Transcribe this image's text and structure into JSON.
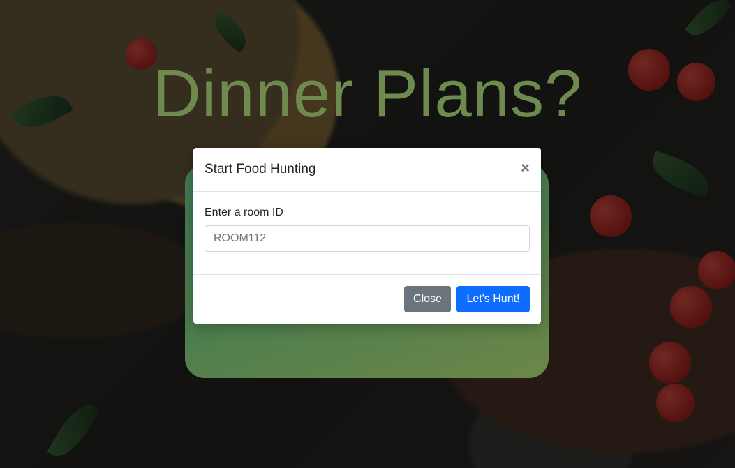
{
  "hero": {
    "title": "Dinner Plans?"
  },
  "modal": {
    "title": "Start Food Hunting",
    "close_icon": "×",
    "field_label": "Enter a room ID",
    "room_input": {
      "value": "",
      "placeholder": "ROOM112"
    },
    "buttons": {
      "close": "Close",
      "hunt": "Let's Hunt!"
    }
  },
  "colors": {
    "title": "#6f8a4e",
    "primary_button": "#0d6efd",
    "secondary_button": "#6c757d",
    "card_gradient_start": "#3f7a54",
    "card_gradient_end": "#6d8748"
  }
}
